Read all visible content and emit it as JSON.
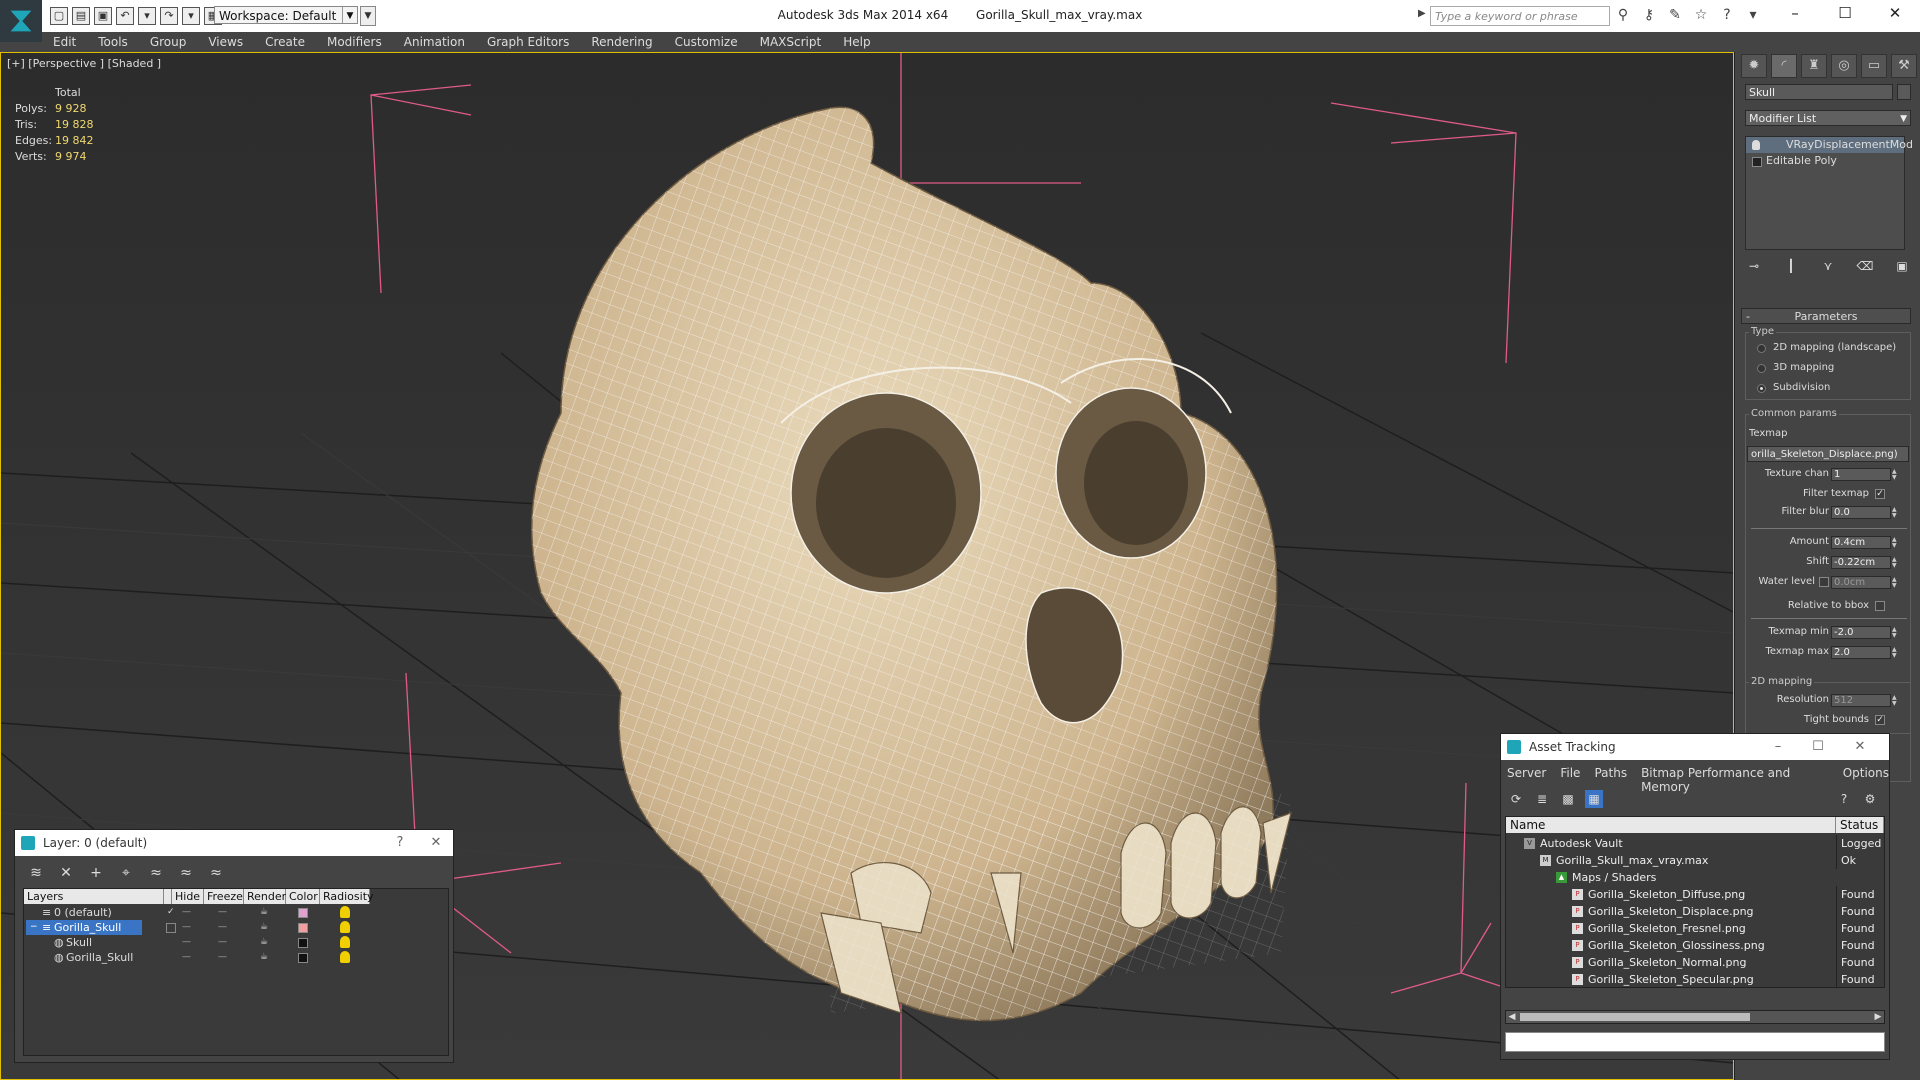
{
  "window": {
    "app_title": "Autodesk 3ds Max  2014 x64",
    "file_title": "Gorilla_Skull_max_vray.max",
    "workspace": "Workspace: Default",
    "search_placeholder": "Type a keyword or phrase",
    "minimize": "–",
    "maximize": "☐",
    "close": "✕"
  },
  "menu": [
    "Edit",
    "Tools",
    "Group",
    "Views",
    "Create",
    "Modifiers",
    "Animation",
    "Graph Editors",
    "Rendering",
    "Customize",
    "MAXScript",
    "Help"
  ],
  "viewport": {
    "label": "[+] [Perspective ] [Shaded ]",
    "stats": {
      "header": "Total",
      "rows": [
        {
          "label": "Polys:",
          "value": "9 928"
        },
        {
          "label": "Tris:",
          "value": "19 828"
        },
        {
          "label": "Edges:",
          "value": "19 842"
        },
        {
          "label": "Verts:",
          "value": "9 974"
        }
      ]
    }
  },
  "command_panel": {
    "object_name": "Skull",
    "modifier_list": "Modifier List",
    "stack": [
      "VRayDisplacementMod",
      "Editable Poly"
    ],
    "parameters": {
      "header": "Parameters",
      "type_label": "Type",
      "types": [
        "2D mapping (landscape)",
        "3D mapping",
        "Subdivision"
      ],
      "selected_type": "Subdivision",
      "common_label": "Common params",
      "texmap_label": "Texmap",
      "texmap_value": "orilla_Skeleton_Displace.png)",
      "texture_chan_label": "Texture chan",
      "texture_chan": "1",
      "filter_texmap_label": "Filter texmap",
      "filter_blur_label": "Filter blur",
      "filter_blur": "0.0",
      "amount_label": "Amount",
      "amount": "0.4cm",
      "shift_label": "Shift",
      "shift": "-0.22cm",
      "water_level_label": "Water level",
      "water_level": "0.0cm",
      "relative_bbox_label": "Relative to bbox",
      "texmap_min_label": "Texmap min",
      "texmap_min": "-2.0",
      "texmap_max_label": "Texmap max",
      "texmap_max": "2.0",
      "mapping2d_label": "2D mapping",
      "resolution_label": "Resolution",
      "resolution": "512",
      "tight_bounds_label": "Tight bounds"
    }
  },
  "layer_window": {
    "title": "Layer: 0 (default)",
    "help": "?",
    "close": "✕",
    "columns": [
      "Layers",
      "Hide",
      "Freeze",
      "Render",
      "Color",
      "Radiosity"
    ],
    "rows": [
      {
        "name": "0 (default)",
        "color": "#e0a0d0",
        "selected": false,
        "indent": 1
      },
      {
        "name": "Gorilla_Skull",
        "color": "#f0a0a0",
        "selected": true,
        "indent": 1
      },
      {
        "name": "Skull",
        "color": "#111111",
        "selected": false,
        "indent": 2
      },
      {
        "name": "Gorilla_Skull",
        "color": "#111111",
        "selected": false,
        "indent": 2
      }
    ]
  },
  "asset_window": {
    "title": "Asset Tracking",
    "menu": [
      "Server",
      "File",
      "Paths",
      "Bitmap Performance and Memory",
      "Options"
    ],
    "columns": [
      "Name",
      "Status"
    ],
    "rows": [
      {
        "name": "Autodesk Vault",
        "status": "Logged Out",
        "indent": 0,
        "icon": "vault-icon"
      },
      {
        "name": "Gorilla_Skull_max_vray.max",
        "status": "Ok",
        "indent": 1,
        "icon": "max-file-icon"
      },
      {
        "name": "Maps / Shaders",
        "status": "",
        "indent": 2,
        "icon": "maps-icon"
      },
      {
        "name": "Gorilla_Skeleton_Diffuse.png",
        "status": "Found",
        "indent": 3,
        "icon": "png-icon"
      },
      {
        "name": "Gorilla_Skeleton_Displace.png",
        "status": "Found",
        "indent": 3,
        "icon": "png-icon"
      },
      {
        "name": "Gorilla_Skeleton_Fresnel.png",
        "status": "Found",
        "indent": 3,
        "icon": "png-icon"
      },
      {
        "name": "Gorilla_Skeleton_Glossiness.png",
        "status": "Found",
        "indent": 3,
        "icon": "png-icon"
      },
      {
        "name": "Gorilla_Skeleton_Normal.png",
        "status": "Found",
        "indent": 3,
        "icon": "png-icon"
      },
      {
        "name": "Gorilla_Skeleton_Specular.png",
        "status": "Found",
        "indent": 3,
        "icon": "png-icon"
      }
    ]
  }
}
